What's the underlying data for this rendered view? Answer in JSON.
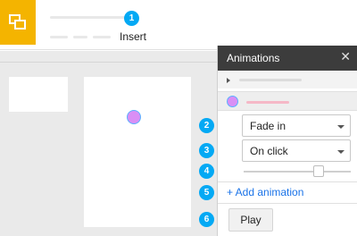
{
  "toolbar": {
    "menu_label": "Insert",
    "logo_icon": "slides-logo-icon",
    "brand_color": "#f4b400"
  },
  "badges": [
    "1",
    "2",
    "3",
    "4",
    "5",
    "6"
  ],
  "panel": {
    "title": "Animations",
    "close_icon": "✕",
    "effect": "Fade in",
    "trigger": "On click",
    "speed": 0.7,
    "add_label": "+ Add animation",
    "play_label": "Play"
  },
  "colors": {
    "badge": "#03a9f4",
    "link": "#1a73e8",
    "shape_fill": "#d98ff5",
    "shape_stroke": "#5bb0ff",
    "panel_header": "#3c3c3c"
  }
}
